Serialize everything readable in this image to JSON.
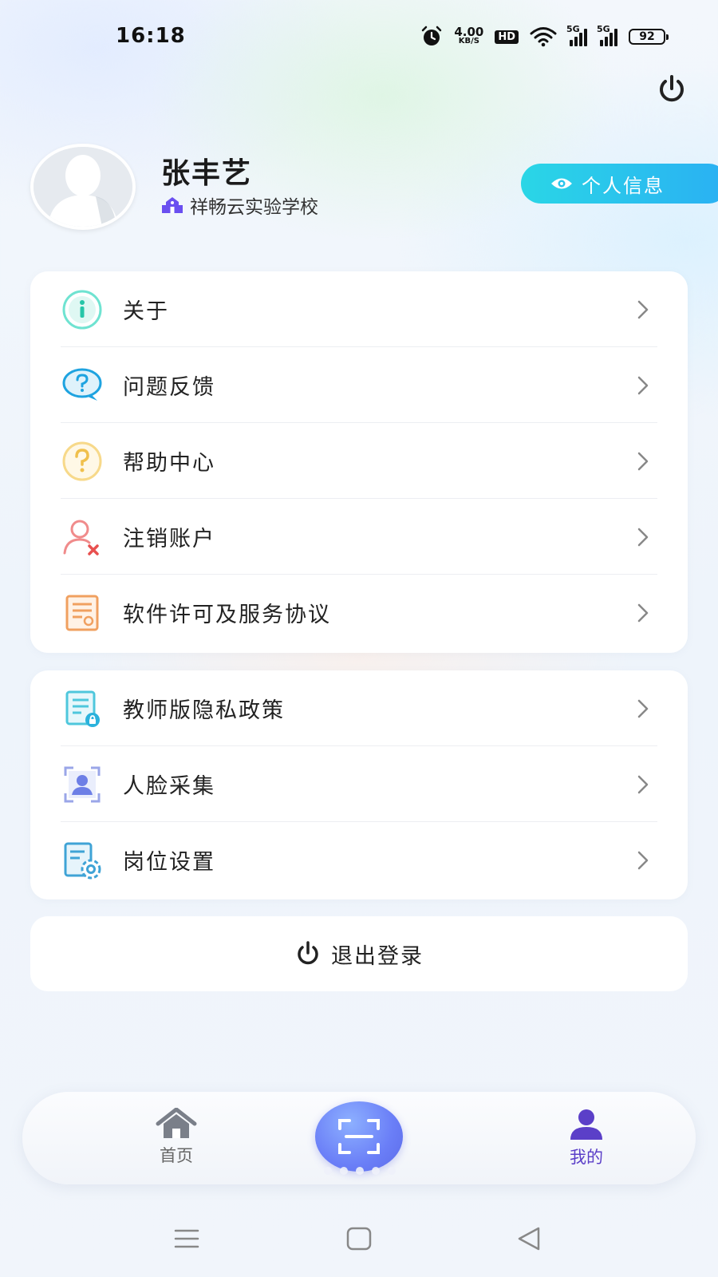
{
  "status_bar": {
    "time": "16:18",
    "net_speed_value": "4.00",
    "net_speed_unit": "KB/S",
    "hd_label": "HD",
    "signal_label_1": "5G",
    "signal_label_2": "5G",
    "battery": "92"
  },
  "profile": {
    "name": "张丰艺",
    "school": "祥畅云实验学校",
    "info_button": "个人信息"
  },
  "menu_group_1": [
    {
      "label": "关于",
      "icon": "info-icon"
    },
    {
      "label": "问题反馈",
      "icon": "feedback-icon"
    },
    {
      "label": "帮助中心",
      "icon": "help-icon"
    },
    {
      "label": "注销账户",
      "icon": "delete-account-icon"
    },
    {
      "label": "软件许可及服务协议",
      "icon": "license-document-icon"
    }
  ],
  "menu_group_2": [
    {
      "label": "教师版隐私政策",
      "icon": "privacy-policy-icon"
    },
    {
      "label": "人脸采集",
      "icon": "face-capture-icon"
    },
    {
      "label": "岗位设置",
      "icon": "position-settings-icon"
    }
  ],
  "logout": {
    "label": "退出登录"
  },
  "tab_bar": {
    "home_label": "首页",
    "mine_label": "我的",
    "active": "我的"
  },
  "colors": {
    "accent": "#2ab0f3",
    "tab_active": "#5b3fc8",
    "scan": "#6a7ef7"
  }
}
